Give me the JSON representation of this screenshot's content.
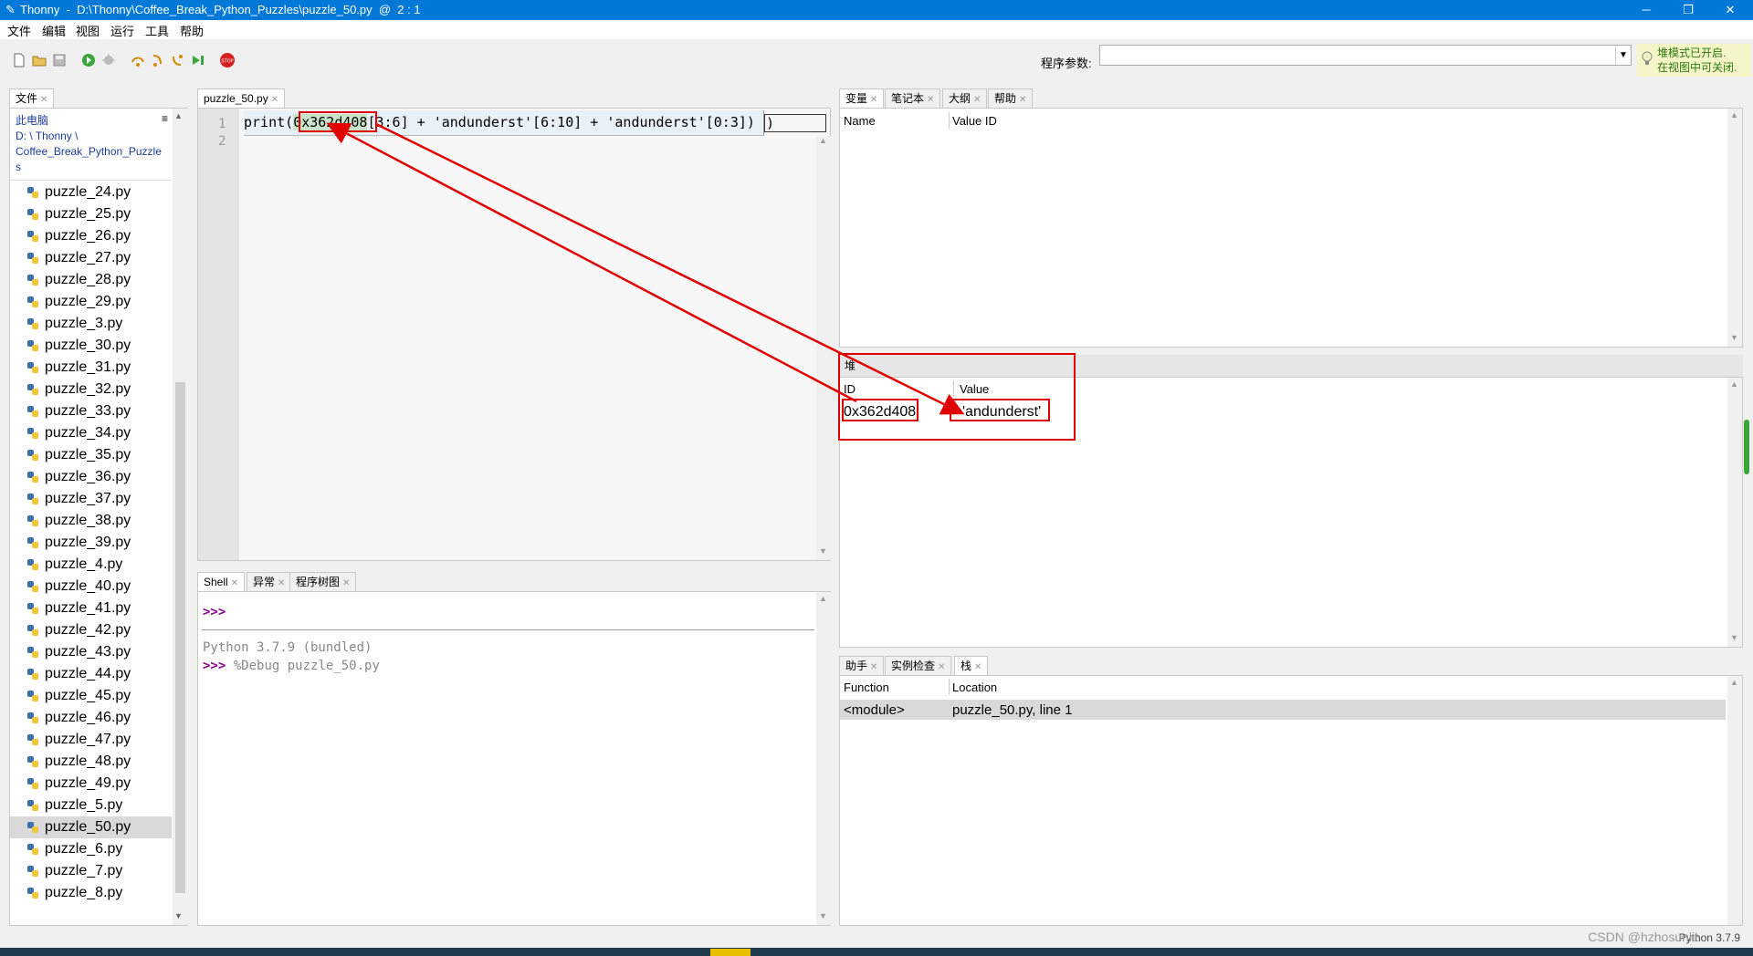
{
  "window": {
    "title": "Thonny  -  D:\\Thonny\\Coffee_Break_Python_Puzzles\\puzzle_50.py  @  2 : 1"
  },
  "menu": [
    "文件",
    "编辑",
    "视图",
    "运行",
    "工具",
    "帮助"
  ],
  "toolbar": {
    "args_label": "程序参数:",
    "args_value": "",
    "tip_line1": "堆模式已开启.",
    "tip_line2": "在视图中可关闭."
  },
  "files_panel": {
    "tab": "文件",
    "path_line1": "此电脑",
    "path_line2": "D: \\ Thonny \\",
    "path_line3": "Coffee_Break_Python_Puzzle",
    "path_line4": "s",
    "items": [
      "puzzle_24.py",
      "puzzle_25.py",
      "puzzle_26.py",
      "puzzle_27.py",
      "puzzle_28.py",
      "puzzle_29.py",
      "puzzle_3.py",
      "puzzle_30.py",
      "puzzle_31.py",
      "puzzle_32.py",
      "puzzle_33.py",
      "puzzle_34.py",
      "puzzle_35.py",
      "puzzle_36.py",
      "puzzle_37.py",
      "puzzle_38.py",
      "puzzle_39.py",
      "puzzle_4.py",
      "puzzle_40.py",
      "puzzle_41.py",
      "puzzle_42.py",
      "puzzle_43.py",
      "puzzle_44.py",
      "puzzle_45.py",
      "puzzle_46.py",
      "puzzle_47.py",
      "puzzle_48.py",
      "puzzle_49.py",
      "puzzle_5.py",
      "puzzle_50.py",
      "puzzle_6.py",
      "puzzle_7.py",
      "puzzle_8.py"
    ],
    "selected": "puzzle_50.py"
  },
  "editor": {
    "tab": "puzzle_50.py",
    "line_numbers": [
      "1",
      "2"
    ],
    "code_pre": "print(",
    "code_highlight": "0x362d408",
    "code_post": "[3:6] + 'andunderst'[6:10] + 'andunderst'[0:3])",
    "code_tail": ")"
  },
  "shell": {
    "tabs": [
      "Shell",
      "异常",
      "程序树图"
    ],
    "prompt": ">>>",
    "line1": "Python 3.7.9 (bundled)",
    "line2": "%Debug puzzle_50.py"
  },
  "variables": {
    "tabs": [
      "变量",
      "笔记本",
      "大纲",
      "帮助"
    ],
    "col_name": "Name",
    "col_value": "Value ID"
  },
  "heap": {
    "title": "堆",
    "col_id": "ID",
    "col_value": "Value",
    "rows": [
      {
        "id": "0x362d408",
        "value": "'andunderst'"
      }
    ]
  },
  "stack": {
    "tabs": [
      "助手",
      "实例检查",
      "栈"
    ],
    "col_function": "Function",
    "col_location": "Location",
    "rows": [
      {
        "function": "<module>",
        "location": "puzzle_50.py, line 1"
      }
    ]
  },
  "statusbar": {
    "interpreter": "Python 3.7.9",
    "watermark": "CSDN @hzhosunlit"
  },
  "colors": {
    "accent": "#0078d7",
    "annotation": "#e00000",
    "prompt": "#8b008b"
  }
}
